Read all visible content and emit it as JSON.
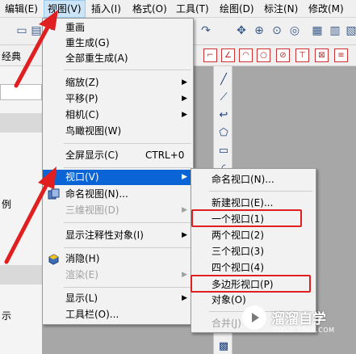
{
  "menubar": {
    "items": [
      {
        "label": "编辑(E)"
      },
      {
        "label": "视图(V)"
      },
      {
        "label": "插入(I)"
      },
      {
        "label": "格式(O)"
      },
      {
        "label": "工具(T)"
      },
      {
        "label": "绘图(D)"
      },
      {
        "label": "标注(N)"
      },
      {
        "label": "修改(M)"
      }
    ]
  },
  "left_panel": {
    "texts": [
      "经典",
      "例",
      "示"
    ]
  },
  "view_menu": {
    "items": [
      {
        "label": "重画",
        "icon": "checkmark-icon"
      },
      {
        "label": "重生成(G)"
      },
      {
        "label": "全部重生成(A)"
      },
      {
        "label": "缩放(Z)",
        "submenu": true
      },
      {
        "label": "平移(P)",
        "submenu": true
      },
      {
        "label": "相机(C)",
        "submenu": true
      },
      {
        "label": "鸟瞰视图(W)"
      },
      {
        "label": "全屏显示(C)",
        "shortcut": "CTRL+0"
      },
      {
        "label": "视口(V)",
        "submenu": true,
        "highlighted": true
      },
      {
        "label": "命名视图(N)...",
        "icon": "named-view-icon"
      },
      {
        "label": "三维视图(D)",
        "submenu": true,
        "disabled": true
      },
      {
        "label": "显示注释性对象(I)",
        "submenu": true
      },
      {
        "label": "消隐(H)",
        "icon": "hide-icon"
      },
      {
        "label": "渲染(E)",
        "submenu": true,
        "disabled": true
      },
      {
        "label": "显示(L)",
        "submenu": true
      },
      {
        "label": "工具栏(O)..."
      }
    ]
  },
  "viewport_submenu": {
    "items": [
      {
        "label": "命名视口(N)..."
      },
      {
        "label": "新建视口(E)..."
      },
      {
        "label": "一个视口(1)",
        "boxed": true
      },
      {
        "label": "两个视口(2)"
      },
      {
        "label": "三个视口(3)"
      },
      {
        "label": "四个视口(4)"
      },
      {
        "label": "多边形视口(P)",
        "boxed": true
      },
      {
        "label": "对象(O)"
      },
      {
        "label": "合并(J)",
        "disabled": true
      }
    ]
  },
  "watermark": {
    "title": "溜溜自学",
    "subtitle": "ZIXUE.3D66.COM"
  },
  "colors": {
    "highlight": "#0a64d6",
    "annotation_red": "#e02020"
  }
}
